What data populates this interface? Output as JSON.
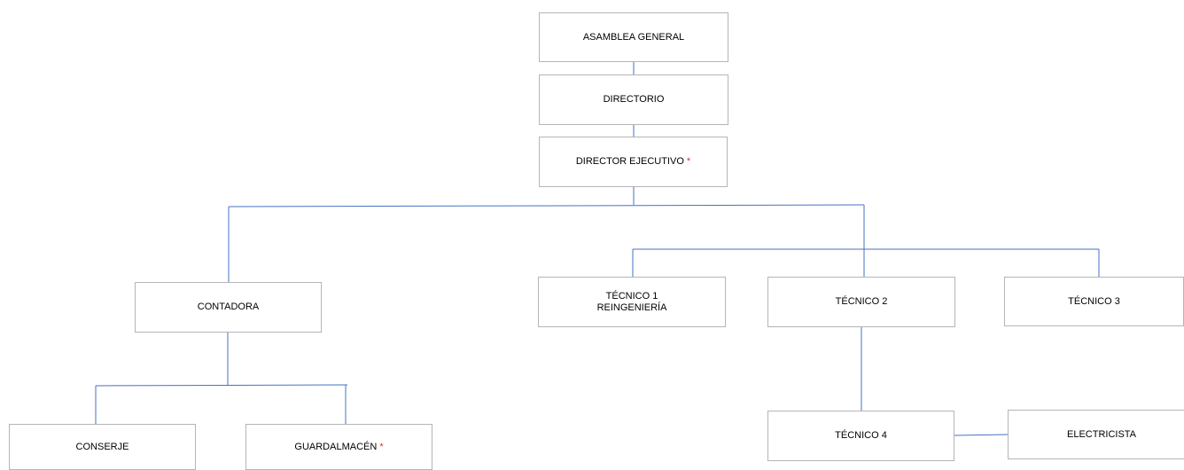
{
  "org_chart": {
    "nodes": {
      "asamblea_general": {
        "label": "ASAMBLEA GENERAL"
      },
      "directorio": {
        "label": "DIRECTORIO"
      },
      "director_ejecutivo": {
        "label": "DIRECTOR EJECUTIVO",
        "marker": "*"
      },
      "contadora": {
        "label": "CONTADORA"
      },
      "tecnico_1": {
        "label_line1": "TÉCNICO 1",
        "label_line2": "REINGENIERÍA"
      },
      "tecnico_2": {
        "label": "TÉCNICO 2"
      },
      "tecnico_3": {
        "label": "TÉCNICO 3"
      },
      "conserje": {
        "label": "CONSERJE"
      },
      "guardalmacen": {
        "label": "GUARDALMACÉN",
        "marker": "*"
      },
      "tecnico_4": {
        "label": "TÉCNICO 4"
      },
      "electricista": {
        "label": "ELECTRICISTA"
      }
    },
    "colors": {
      "connector": "#4472c4",
      "box_border": "#b5b5b5",
      "marker": "#e03030"
    }
  }
}
